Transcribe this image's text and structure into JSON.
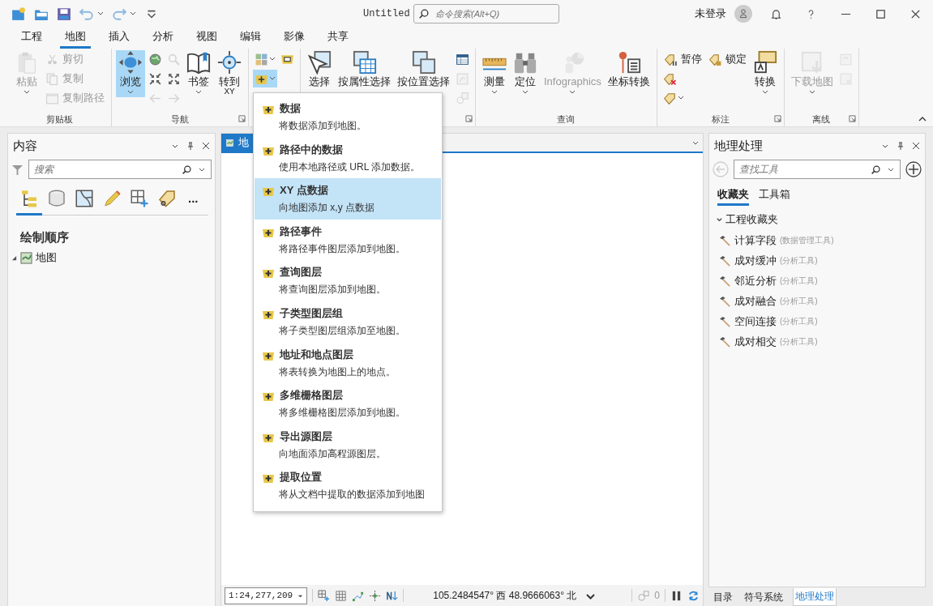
{
  "window": {
    "title": "Untitled",
    "search_placeholder": "命令搜索(Alt+Q)",
    "user": "未登录"
  },
  "ribbon_tabs": [
    {
      "label": "工程",
      "selected": false
    },
    {
      "label": "地图",
      "selected": true
    },
    {
      "label": "插入",
      "selected": false
    },
    {
      "label": "分析",
      "selected": false
    },
    {
      "label": "视图",
      "selected": false
    },
    {
      "label": "编辑",
      "selected": false
    },
    {
      "label": "影像",
      "selected": false
    },
    {
      "label": "共享",
      "selected": false
    }
  ],
  "ribbon_groups": [
    {
      "label": "剪贴板",
      "columns": [
        [
          {
            "kind": "large",
            "label": "粘贴",
            "disabled": true,
            "caret": true,
            "selected": false
          }
        ],
        [
          {
            "kind": "small",
            "label": "剪切",
            "disabled": true,
            "caret": false,
            "selected": false
          },
          {
            "kind": "small",
            "label": "复制",
            "disabled": true,
            "caret": false,
            "selected": false
          },
          {
            "kind": "small",
            "label": "复制路径",
            "disabled": true,
            "caret": false,
            "selected": false
          }
        ]
      ]
    },
    {
      "label": "导航",
      "launcher": true,
      "columns": [
        [
          {
            "kind": "large",
            "label": "浏览",
            "disabled": false,
            "caret": true,
            "selected": true
          }
        ],
        [
          {
            "kind": "icon",
            "disabled": false,
            "caret": false,
            "selected": false
          },
          {
            "kind": "icon",
            "disabled": false,
            "caret": false,
            "selected": false
          },
          {
            "kind": "icon",
            "disabled": true,
            "caret": false,
            "selected": false
          }
        ],
        [
          {
            "kind": "icon",
            "disabled": true,
            "caret": false,
            "selected": false
          },
          {
            "kind": "icon",
            "disabled": false,
            "caret": false,
            "selected": false
          },
          {
            "kind": "icon",
            "disabled": true,
            "caret": false,
            "selected": false
          }
        ],
        [
          {
            "kind": "large",
            "label": "书签",
            "disabled": false,
            "caret": true,
            "selected": false
          }
        ],
        [
          {
            "kind": "large",
            "label": "转到",
            "sublabel": "XY",
            "disabled": false,
            "caret": false,
            "selected": false
          }
        ]
      ]
    },
    {
      "columns": [
        [
          {
            "kind": "icon",
            "disabled": false,
            "caret": true,
            "selected": false
          },
          {
            "kind": "icon",
            "disabled": false,
            "caret": true,
            "selected": true
          }
        ],
        [
          {
            "kind": "icon",
            "disabled": false,
            "caret": false,
            "selected": false
          }
        ]
      ]
    },
    {
      "launcher": true,
      "columns": [
        [
          {
            "kind": "large",
            "label": "选择",
            "disabled": false,
            "caret": false,
            "selected": false
          }
        ],
        [
          {
            "kind": "large",
            "label": "按属性选择",
            "disabled": false,
            "caret": false,
            "selected": false
          }
        ],
        [
          {
            "kind": "large",
            "label": "按位置选择",
            "disabled": false,
            "caret": false,
            "selected": false
          }
        ],
        [
          {
            "kind": "icon",
            "disabled": false,
            "caret": false,
            "selected": false
          },
          {
            "kind": "icon",
            "disabled": true,
            "caret": false,
            "selected": false
          },
          {
            "kind": "icon",
            "disabled": true,
            "caret": false,
            "selected": false
          }
        ]
      ]
    },
    {
      "label": "查询",
      "columns": [
        [
          {
            "kind": "large",
            "label": "测量",
            "disabled": false,
            "caret": true,
            "selected": false
          }
        ],
        [
          {
            "kind": "large",
            "label": "定位",
            "disabled": false,
            "caret": true,
            "selected": false
          }
        ],
        [
          {
            "kind": "large",
            "label": "Infographics",
            "disabled": true,
            "caret": true,
            "selected": false
          }
        ],
        [
          {
            "kind": "large",
            "label": "坐标转换",
            "disabled": false,
            "caret": false,
            "selected": false
          }
        ]
      ]
    },
    {
      "label": "标注",
      "launcher": true,
      "columns": [
        [
          {
            "kind": "small",
            "label": "暂停",
            "disabled": false,
            "caret": false,
            "selected": false
          },
          {
            "kind": "icon",
            "disabled": false,
            "caret": false,
            "selected": false
          },
          {
            "kind": "icon",
            "disabled": false,
            "caret": true,
            "selected": false
          }
        ],
        [
          {
            "kind": "small",
            "label": "锁定",
            "disabled": false,
            "caret": false,
            "selected": false
          }
        ],
        [
          {
            "kind": "large",
            "label": "转换",
            "disabled": false,
            "caret": true,
            "selected": false
          }
        ]
      ]
    },
    {
      "label": "离线",
      "launcher": true,
      "columns": [
        [
          {
            "kind": "large",
            "label": "下载地图",
            "disabled": true,
            "caret": true,
            "selected": false
          }
        ],
        [
          {
            "kind": "icon",
            "disabled": true,
            "caret": false,
            "selected": false
          },
          {
            "kind": "icon",
            "disabled": true,
            "caret": false,
            "selected": false
          }
        ]
      ]
    }
  ],
  "contents_pane": {
    "title": "内容",
    "search_placeholder": "搜索",
    "view_tabs": [
      {
        "selected": true
      },
      {
        "selected": false
      },
      {
        "selected": false
      },
      {
        "selected": false
      },
      {
        "selected": false
      },
      {
        "selected": false
      }
    ],
    "more": "...",
    "heading": "绘制顺序",
    "tree": [
      {
        "label": "地图",
        "expanded": true
      }
    ]
  },
  "map_view": {
    "tab": "地",
    "status_bar": {
      "scale": "1:24,277,209",
      "coordinates": "105.2484547° 西 48.9666063° 北",
      "selection_count": "0"
    }
  },
  "add_data_menu": [
    {
      "title": "数据",
      "description": "将数据添加到地图。",
      "selected": false
    },
    {
      "title": "路径中的数据",
      "description": "使用本地路径或 URL 添加数据。",
      "selected": false
    },
    {
      "title": "XY 点数据",
      "description": "向地图添加 x,y 点数据",
      "selected": true
    },
    {
      "title": "路径事件",
      "description": "将路径事件图层添加到地图。",
      "selected": false
    },
    {
      "title": "查询图层",
      "description": "将查询图层添加到地图。",
      "selected": false
    },
    {
      "title": "子类型图层组",
      "description": "将子类型图层组添加至地图。",
      "selected": false
    },
    {
      "title": "地址和地点图层",
      "description": "将表转换为地图上的地点。",
      "selected": false
    },
    {
      "title": "多维栅格图层",
      "description": "将多维栅格图层添加到地图。",
      "selected": false
    },
    {
      "title": "导出源图层",
      "description": "向地面添加高程源图层。",
      "selected": false
    },
    {
      "title": "提取位置",
      "description": "将从文档中提取的数据添加到地图",
      "selected": false
    }
  ],
  "geoprocessing_pane": {
    "title": "地理处理",
    "back_disabled": true,
    "search_placeholder": "查找工具",
    "tabs": [
      {
        "label": "收藏夹",
        "selected": true
      },
      {
        "label": "工具箱",
        "selected": false
      }
    ],
    "section": {
      "label": "工程收藏夹",
      "expanded": true,
      "items": [
        {
          "name": "计算字段",
          "toolbox": "(数据管理工具)"
        },
        {
          "name": "成对缓冲",
          "toolbox": "(分析工具)"
        },
        {
          "name": "邻近分析",
          "toolbox": "(分析工具)"
        },
        {
          "name": "成对融合",
          "toolbox": "(分析工具)"
        },
        {
          "name": "空间连接",
          "toolbox": "(分析工具)"
        },
        {
          "name": "成对相交",
          "toolbox": "(分析工具)"
        }
      ]
    }
  },
  "bottom_tabs": [
    {
      "label": "目录",
      "selected": false
    },
    {
      "label": "符号系统",
      "selected": false
    },
    {
      "label": "地理处理",
      "selected": true
    }
  ]
}
